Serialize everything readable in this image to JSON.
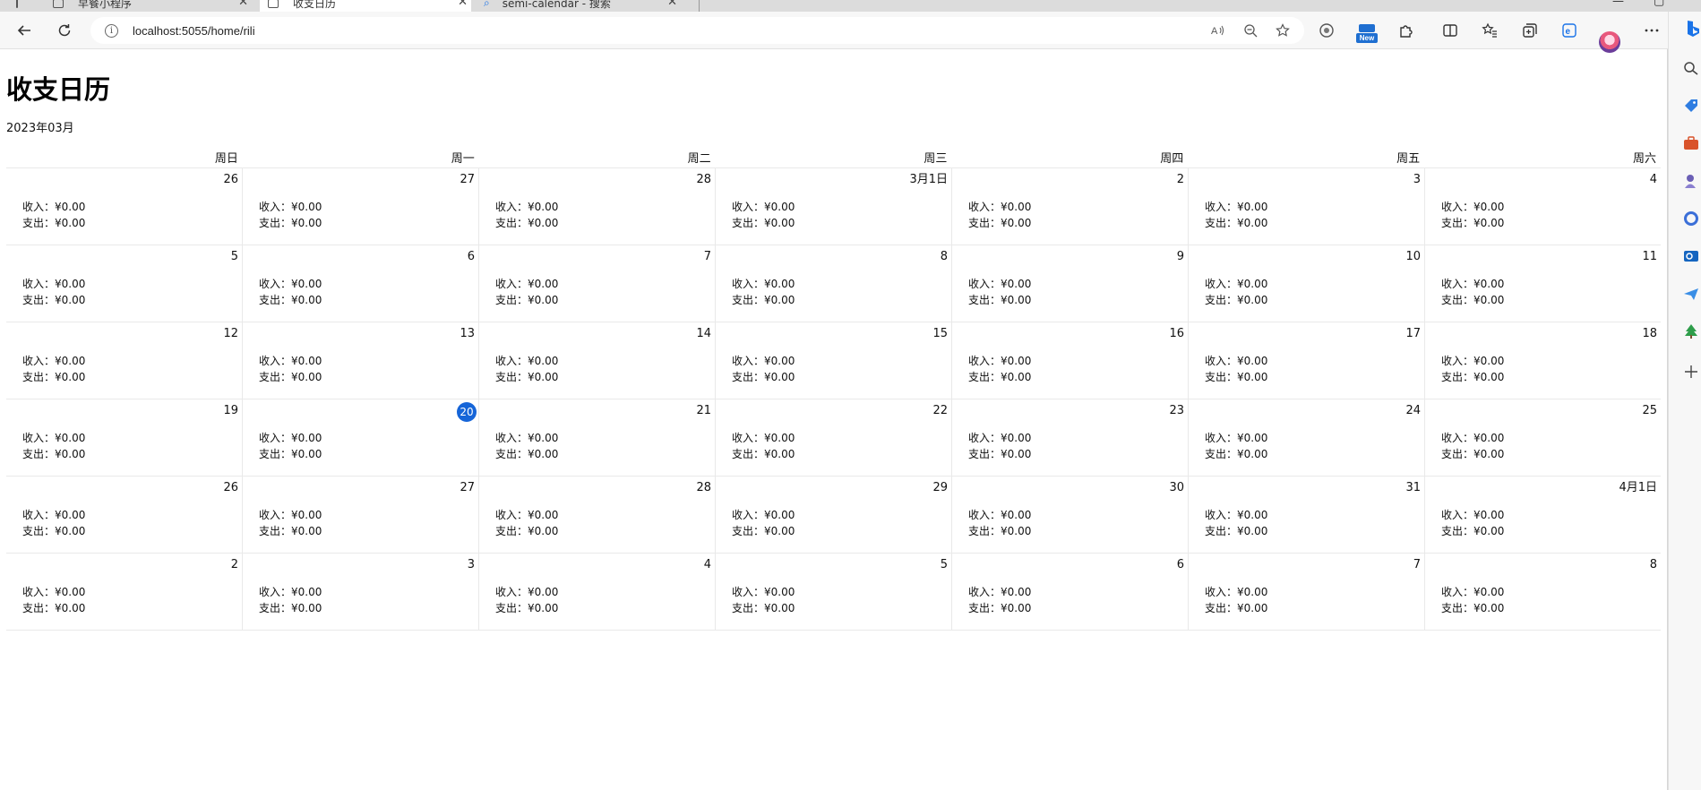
{
  "browser": {
    "tabs": [
      {
        "title": "早餐小程序",
        "active": false
      },
      {
        "title": "收支日历",
        "active": true
      },
      {
        "title": "semi-calendar - 搜索",
        "active": false
      }
    ],
    "url": "localhost:5055/home/rili",
    "new_badge": "New"
  },
  "page": {
    "title": "收支日历",
    "month": "2023年03月"
  },
  "calendar": {
    "weekdays": [
      "周日",
      "周一",
      "周二",
      "周三",
      "周四",
      "周五",
      "周六"
    ],
    "income_label": "收入：",
    "expense_label": "支出：",
    "today": "20",
    "weeks": [
      [
        {
          "day": "26",
          "income": "¥0.00",
          "expense": "¥0.00"
        },
        {
          "day": "27",
          "income": "¥0.00",
          "expense": "¥0.00"
        },
        {
          "day": "28",
          "income": "¥0.00",
          "expense": "¥0.00"
        },
        {
          "day": "3月1日",
          "income": "¥0.00",
          "expense": "¥0.00"
        },
        {
          "day": "2",
          "income": "¥0.00",
          "expense": "¥0.00"
        },
        {
          "day": "3",
          "income": "¥0.00",
          "expense": "¥0.00"
        },
        {
          "day": "4",
          "income": "¥0.00",
          "expense": "¥0.00"
        }
      ],
      [
        {
          "day": "5",
          "income": "¥0.00",
          "expense": "¥0.00"
        },
        {
          "day": "6",
          "income": "¥0.00",
          "expense": "¥0.00"
        },
        {
          "day": "7",
          "income": "¥0.00",
          "expense": "¥0.00"
        },
        {
          "day": "8",
          "income": "¥0.00",
          "expense": "¥0.00"
        },
        {
          "day": "9",
          "income": "¥0.00",
          "expense": "¥0.00"
        },
        {
          "day": "10",
          "income": "¥0.00",
          "expense": "¥0.00"
        },
        {
          "day": "11",
          "income": "¥0.00",
          "expense": "¥0.00"
        }
      ],
      [
        {
          "day": "12",
          "income": "¥0.00",
          "expense": "¥0.00"
        },
        {
          "day": "13",
          "income": "¥0.00",
          "expense": "¥0.00"
        },
        {
          "day": "14",
          "income": "¥0.00",
          "expense": "¥0.00"
        },
        {
          "day": "15",
          "income": "¥0.00",
          "expense": "¥0.00"
        },
        {
          "day": "16",
          "income": "¥0.00",
          "expense": "¥0.00"
        },
        {
          "day": "17",
          "income": "¥0.00",
          "expense": "¥0.00"
        },
        {
          "day": "18",
          "income": "¥0.00",
          "expense": "¥0.00"
        }
      ],
      [
        {
          "day": "19",
          "income": "¥0.00",
          "expense": "¥0.00"
        },
        {
          "day": "20",
          "income": "¥0.00",
          "expense": "¥0.00"
        },
        {
          "day": "21",
          "income": "¥0.00",
          "expense": "¥0.00"
        },
        {
          "day": "22",
          "income": "¥0.00",
          "expense": "¥0.00"
        },
        {
          "day": "23",
          "income": "¥0.00",
          "expense": "¥0.00"
        },
        {
          "day": "24",
          "income": "¥0.00",
          "expense": "¥0.00"
        },
        {
          "day": "25",
          "income": "¥0.00",
          "expense": "¥0.00"
        }
      ],
      [
        {
          "day": "26",
          "income": "¥0.00",
          "expense": "¥0.00"
        },
        {
          "day": "27",
          "income": "¥0.00",
          "expense": "¥0.00"
        },
        {
          "day": "28",
          "income": "¥0.00",
          "expense": "¥0.00"
        },
        {
          "day": "29",
          "income": "¥0.00",
          "expense": "¥0.00"
        },
        {
          "day": "30",
          "income": "¥0.00",
          "expense": "¥0.00"
        },
        {
          "day": "31",
          "income": "¥0.00",
          "expense": "¥0.00"
        },
        {
          "day": "4月1日",
          "income": "¥0.00",
          "expense": "¥0.00"
        }
      ],
      [
        {
          "day": "2",
          "income": "¥0.00",
          "expense": "¥0.00"
        },
        {
          "day": "3",
          "income": "¥0.00",
          "expense": "¥0.00"
        },
        {
          "day": "4",
          "income": "¥0.00",
          "expense": "¥0.00"
        },
        {
          "day": "5",
          "income": "¥0.00",
          "expense": "¥0.00"
        },
        {
          "day": "6",
          "income": "¥0.00",
          "expense": "¥0.00"
        },
        {
          "day": "7",
          "income": "¥0.00",
          "expense": "¥0.00"
        },
        {
          "day": "8",
          "income": "¥0.00",
          "expense": "¥0.00"
        }
      ]
    ]
  },
  "colors": {
    "today_highlight": "#1665d8",
    "grid_line": "#e9e9e9"
  }
}
